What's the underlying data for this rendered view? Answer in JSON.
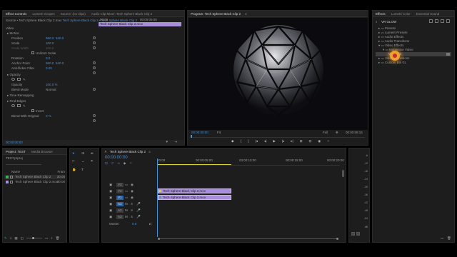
{
  "effect_controls": {
    "tabs": [
      "Effect Controls",
      "Lumetri Scopes",
      "Source: (no clips)",
      "Audio Clip Mixer: Tech Sphere Black Clip 2"
    ],
    "source_label": "Source • Tech Sphere Black Clip 2.mov",
    "sequence_label": "Tech Sphere Black Clip 2 • Tech Sphere Black Clip 2",
    "time_start": "00:00",
    "time_end": "00:00:05:00",
    "clip_bar": "Tech Sphere Black Clip 2.mov",
    "section_video": "Video",
    "motion": "Motion",
    "position_label": "Position",
    "position_x": "960.0",
    "position_y": "540.0",
    "scale_label": "Scale",
    "scale_value": "100.0",
    "scale_width_label": "Scale Width",
    "scale_width_value": "100.0",
    "uniform_scale": "Uniform Scale",
    "rotation_label": "Rotation",
    "rotation_value": "0.0",
    "anchor_label": "Anchor Point",
    "anchor_x": "960.0",
    "anchor_y": "540.0",
    "antiflicker_label": "Anti-flicker Filter",
    "antiflicker_value": "0.00",
    "opacity_section": "Opacity",
    "opacity_label": "Opacity",
    "opacity_value": "100.0 %",
    "blend_label": "Blend Mode",
    "blend_value": "Normal",
    "time_remapping": "Time Remapping",
    "find_edges": "Find Edges",
    "invert_label": "Invert",
    "blend_original_label": "Blend With Original",
    "blend_original_value": "0 %",
    "timecode": "00:00:00:00"
  },
  "program": {
    "title": "Program: Tech Sphere Black Clip 2",
    "timecode": "00:00:00:00",
    "fit": "Fit",
    "quality": "Full",
    "duration": "00:00:08:15"
  },
  "effects_panel": {
    "tabs": [
      "Effects",
      "Lumetri Color",
      "Essential Sound"
    ],
    "search_value": "VR GLOW",
    "items": [
      "Presets",
      "Lumetri Presets",
      "Audio Effects",
      "Audio Transitions",
      "Video Effects",
      "Immersive Video",
      "VR Glow",
      "Video Transitions",
      "Custom Bin 01"
    ]
  },
  "project": {
    "tabs": [
      "Project: TEST",
      "Media Browser"
    ],
    "project_file": "TEST.prproj",
    "col_name": "Name",
    "col_frame": "Fram",
    "items": [
      {
        "name": "Tech Sphere Black Clip 2",
        "fps": "30.00"
      },
      {
        "name": "Tech Sphere Black Clip 2.mov",
        "fps": "30.00"
      }
    ]
  },
  "timeline": {
    "tab": "Tech Sphere Black Clip 2",
    "timecode": "00:00:00:00",
    "ruler": [
      "00:00",
      "00:00:05:00",
      "00:00:10:00",
      "00:00:15:00",
      "00:00:20:00"
    ],
    "video_tracks": [
      "V3",
      "V2",
      "V1"
    ],
    "audio_tracks": [
      "A1",
      "A2",
      "A3"
    ],
    "track_letters": [
      "M",
      "S"
    ],
    "master_label": "Master",
    "master_value": "0.0",
    "clip_v1": "Tech Sphere Black Clip 2.mov",
    "clip_a1": "Tech Sphere Black Clip 2.mov"
  },
  "meter": {
    "labels": [
      "-6",
      "-12",
      "-18",
      "-24",
      "-30",
      "-36",
      "-42",
      "-48",
      "-54",
      "dB"
    ],
    "bottom": [
      "S",
      "S"
    ]
  },
  "colors": {
    "accent_blue": "#4a90d9",
    "clip_purple": "#a98fd9",
    "cursor_orange": "#f0a030"
  }
}
